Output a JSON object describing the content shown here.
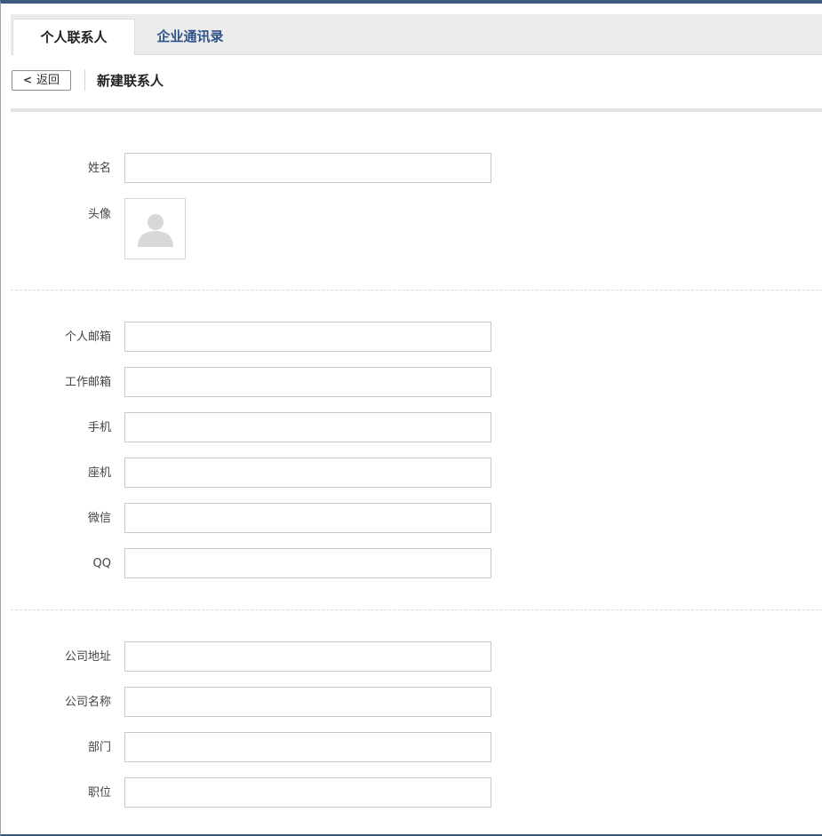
{
  "tabs": {
    "personal": "个人联系人",
    "enterprise": "企业通讯录"
  },
  "toolbar": {
    "back_label": "返回",
    "title": "新建联系人"
  },
  "form": {
    "name_label": "姓名",
    "name_value": "",
    "avatar_label": "头像",
    "avatar_icon": "user-placeholder-icon",
    "personal_email_label": "个人邮箱",
    "personal_email_value": "",
    "work_email_label": "工作邮箱",
    "work_email_value": "",
    "mobile_label": "手机",
    "mobile_value": "",
    "landline_label": "座机",
    "landline_value": "",
    "wechat_label": "微信",
    "wechat_value": "",
    "qq_label": "QQ",
    "qq_value": "",
    "company_address_label": "公司地址",
    "company_address_value": "",
    "company_name_label": "公司名称",
    "company_name_value": "",
    "department_label": "部门",
    "department_value": "",
    "position_label": "职位",
    "position_value": ""
  },
  "colors": {
    "accent": "#2d5288",
    "frame": "#3c5a80"
  }
}
